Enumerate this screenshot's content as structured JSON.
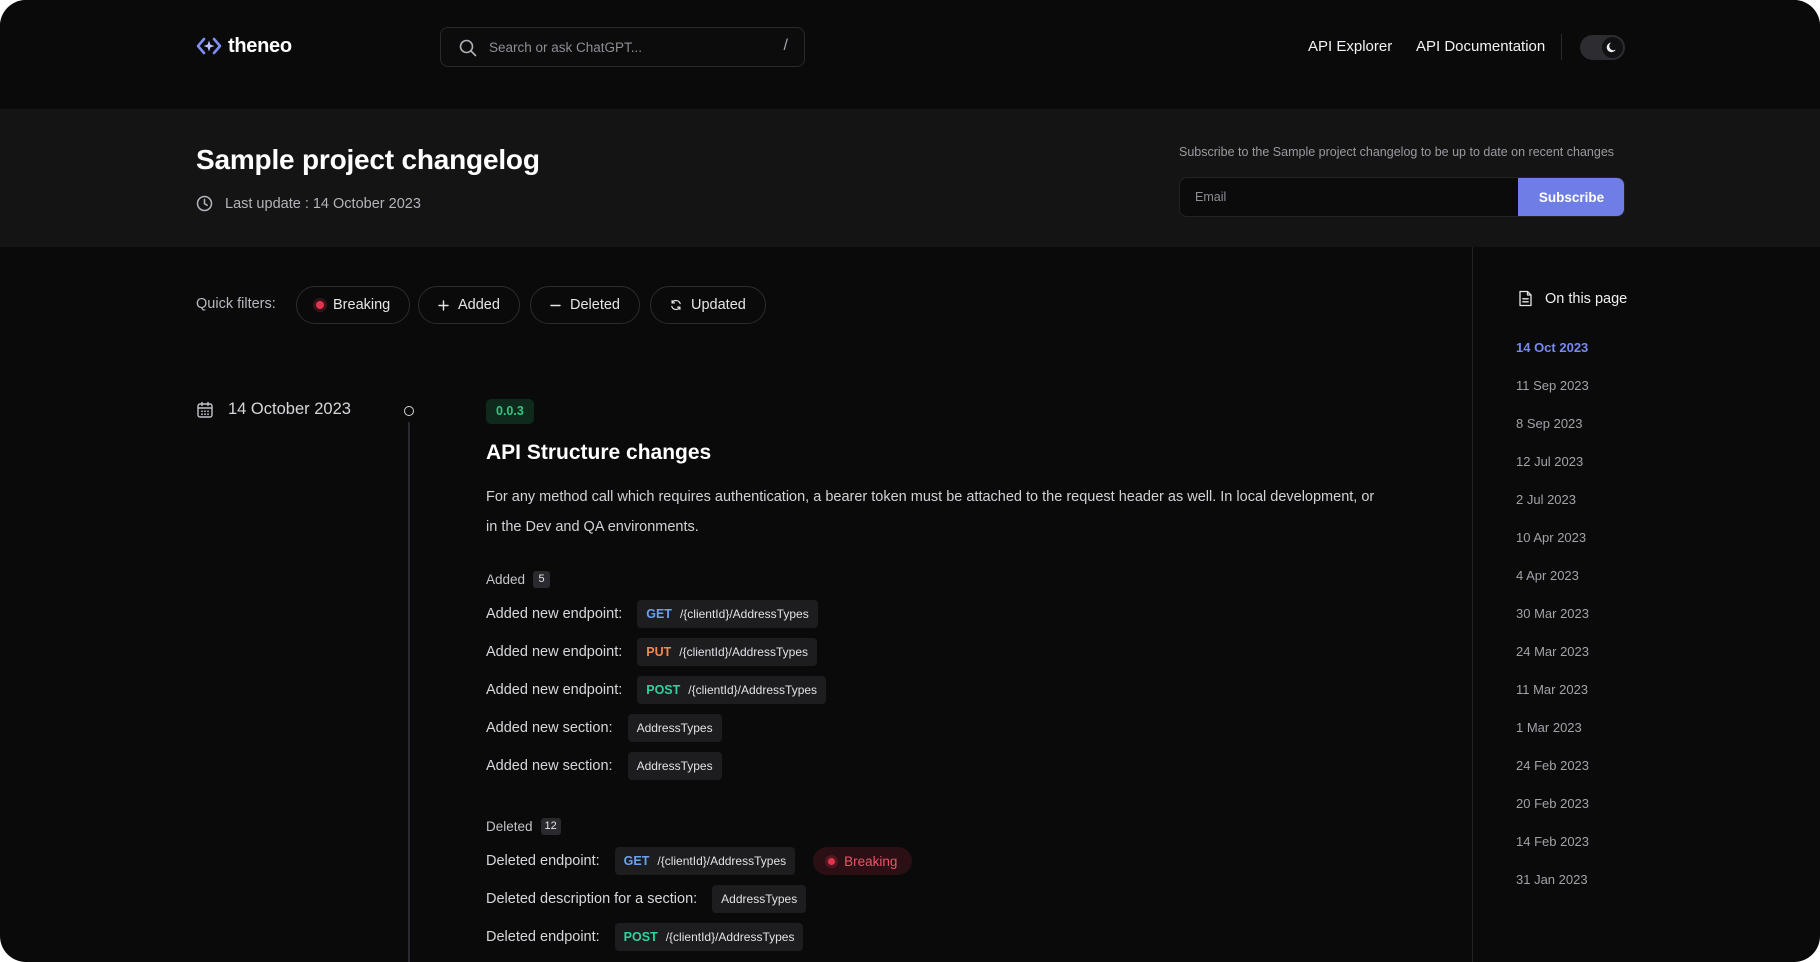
{
  "header": {
    "logo_text": "theneo",
    "search_placeholder": "Search or ask ChatGPT...",
    "search_shortcut": "/",
    "nav": [
      "API Explorer",
      "API Documentation"
    ],
    "theme_icon": "moon-icon"
  },
  "hero": {
    "title": "Sample project changelog",
    "last_update": "Last update : 14 October 2023",
    "subscribe_text": "Subscribe to the Sample project changelog to be up to date on recent changes",
    "email_placeholder": "Email",
    "subscribe_label": "Subscribe",
    "accent_color": "#6f7ee6"
  },
  "filters": {
    "label": "Quick filters:",
    "items": [
      "Breaking",
      "Added",
      "Deleted",
      "Updated"
    ]
  },
  "entry": {
    "date": "14 October 2023",
    "version": "0.0.3",
    "title": "API Structure changes",
    "description": "For any method call which requires authentication, a bearer token must be attached to the request header as well. In local development, or in the Dev and QA environments.",
    "added": {
      "label": "Added",
      "count": "5",
      "rows": [
        {
          "text": "Added new endpoint:",
          "method": "GET",
          "path": "/{clientId}/AddressTypes"
        },
        {
          "text": "Added new endpoint:",
          "method": "PUT",
          "path": "/{clientId}/AddressTypes"
        },
        {
          "text": "Added new endpoint:",
          "method": "POST",
          "path": "/{clientId}/AddressTypes"
        },
        {
          "text": "Added new section:",
          "section": "AddressTypes"
        },
        {
          "text": "Added new section:",
          "section": "AddressTypes"
        }
      ]
    },
    "deleted": {
      "label": "Deleted",
      "count": "12",
      "rows": [
        {
          "text": "Deleted endpoint:",
          "method": "GET",
          "path": "/{clientId}/AddressTypes",
          "badge": "Breaking"
        },
        {
          "text": "Deleted description for a section:",
          "section": "AddressTypes"
        },
        {
          "text": "Deleted endpoint:",
          "method": "POST",
          "path": "/{clientId}/AddressTypes"
        }
      ]
    }
  },
  "toc": {
    "title": "On this page",
    "items": [
      "14 Oct 2023",
      "11 Sep 2023",
      "8 Sep 2023",
      "12 Jul 2023",
      "2 Jul 2023",
      "10 Apr 2023",
      "4 Apr 2023",
      "30 Mar 2023",
      "24 Mar 2023",
      "11 Mar 2023",
      "1 Mar 2023",
      "24 Feb 2023",
      "20 Feb 2023",
      "14 Feb 2023",
      "31 Jan 2023"
    ],
    "active_index": 0
  }
}
